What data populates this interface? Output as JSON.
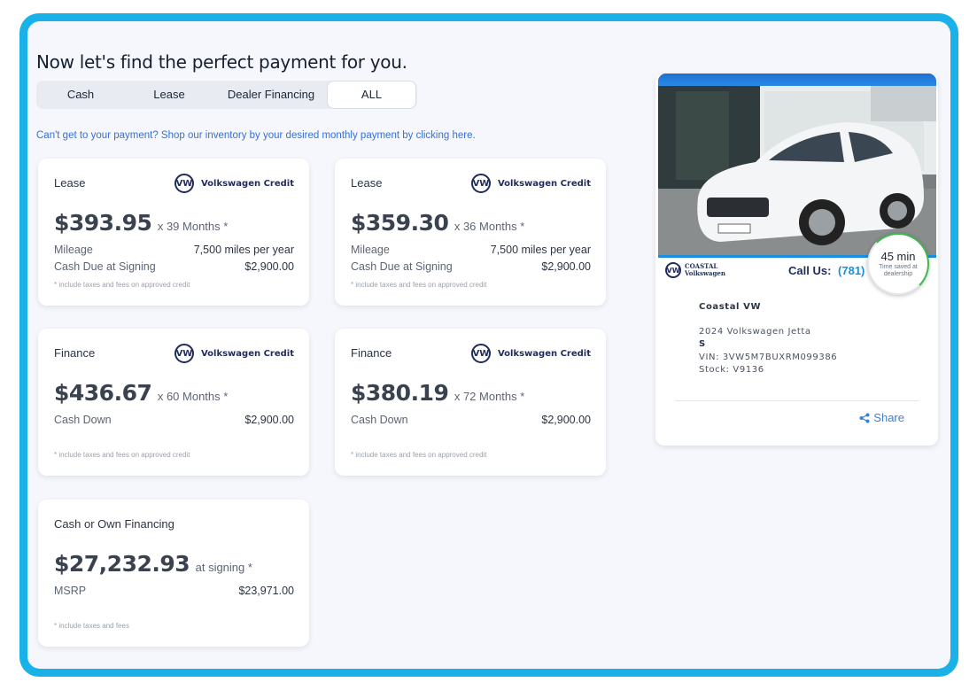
{
  "heading": "Now let's find the perfect payment for you.",
  "tabs": [
    {
      "label": "Cash"
    },
    {
      "label": "Lease"
    },
    {
      "label": "Dealer Financing"
    },
    {
      "label": "ALL"
    }
  ],
  "inventory_link": "Can't get to your payment? Shop our inventory by your desired monthly payment by clicking here.",
  "cards": [
    {
      "type": "Lease",
      "lender": "Volkswagen Credit",
      "price": "$393.95",
      "term": "x 39 Months *",
      "rows": [
        {
          "label": "Mileage",
          "value": "7,500 miles per year"
        },
        {
          "label": "Cash Due at Signing",
          "value": "$2,900.00"
        }
      ],
      "disclaimer": "* include taxes and fees on approved credit"
    },
    {
      "type": "Lease",
      "lender": "Volkswagen Credit",
      "price": "$359.30",
      "term": "x 36 Months *",
      "rows": [
        {
          "label": "Mileage",
          "value": "7,500 miles per year"
        },
        {
          "label": "Cash Due at Signing",
          "value": "$2,900.00"
        }
      ],
      "disclaimer": "* include taxes and fees on approved credit"
    },
    {
      "type": "Finance",
      "lender": "Volkswagen Credit",
      "price": "$436.67",
      "term": "x 60 Months *",
      "rows": [
        {
          "label": "Cash Down",
          "value": "$2,900.00"
        }
      ],
      "disclaimer": "* include taxes and fees on approved credit"
    },
    {
      "type": "Finance",
      "lender": "Volkswagen Credit",
      "price": "$380.19",
      "term": "x 72 Months *",
      "rows": [
        {
          "label": "Cash Down",
          "value": "$2,900.00"
        }
      ],
      "disclaimer": "* include taxes and fees on approved credit"
    },
    {
      "type": "Cash or Own Financing",
      "price": "$27,232.93",
      "term": "at signing *",
      "rows": [
        {
          "label": "MSRP",
          "value": "$23,971.00"
        }
      ],
      "disclaimer": "* include taxes and fees"
    }
  ],
  "vehicle": {
    "dealer_logo": [
      "COASTAL",
      "Volkswagen"
    ],
    "call_label": "Call Us:",
    "phone": "(781)",
    "badge_time": "45 min",
    "badge_sub": "Time saved at dealership",
    "dealer": "Coastal VW",
    "title": "2024 Volkswagen Jetta",
    "trim": "S",
    "vin": "VIN: 3VW5M7BUXRM099386",
    "stock": "Stock: V9136",
    "share": "Share"
  }
}
